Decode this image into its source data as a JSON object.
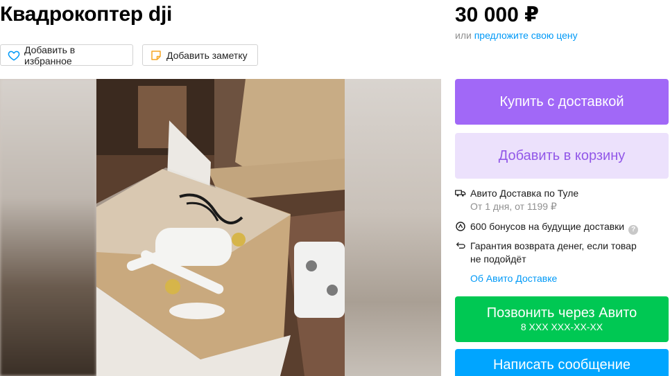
{
  "listing": {
    "title": "Квадрокоптер dji",
    "price": "30 000 ₽",
    "offer_prefix": "или",
    "offer_link": "предложите свою цену"
  },
  "actions": {
    "favorite_label": "Добавить в избранное",
    "note_label": "Добавить заметку"
  },
  "sidebar": {
    "buy_label": "Купить с доставкой",
    "cart_label": "Добавить в корзину",
    "delivery_title": "Авито Доставка по Туле",
    "delivery_details": "От 1 дня, от 1199 ₽",
    "bonus_text": "600 бонусов на будущие доставки",
    "help_symbol": "?",
    "guarantee_line1": "Гарантия возврата денег, если товар",
    "guarantee_line2": "не подойдёт",
    "about_link": "Об Авито Доставке",
    "call_label": "Позвонить через Авито",
    "call_phone": "8 XXX XXX-XX-XX",
    "message_label": "Написать сообщение"
  },
  "colors": {
    "buy_button": "#a168f7",
    "cart_button": "#ece1fc",
    "call_button": "#00c853",
    "message_button": "#00a5ff",
    "link": "#0099f7"
  },
  "icons": {
    "favorite": "heart-icon",
    "note": "note-icon",
    "delivery": "truck-icon",
    "bonus": "bonus-coin-icon",
    "guarantee": "return-arrow-icon",
    "help": "help-icon"
  }
}
